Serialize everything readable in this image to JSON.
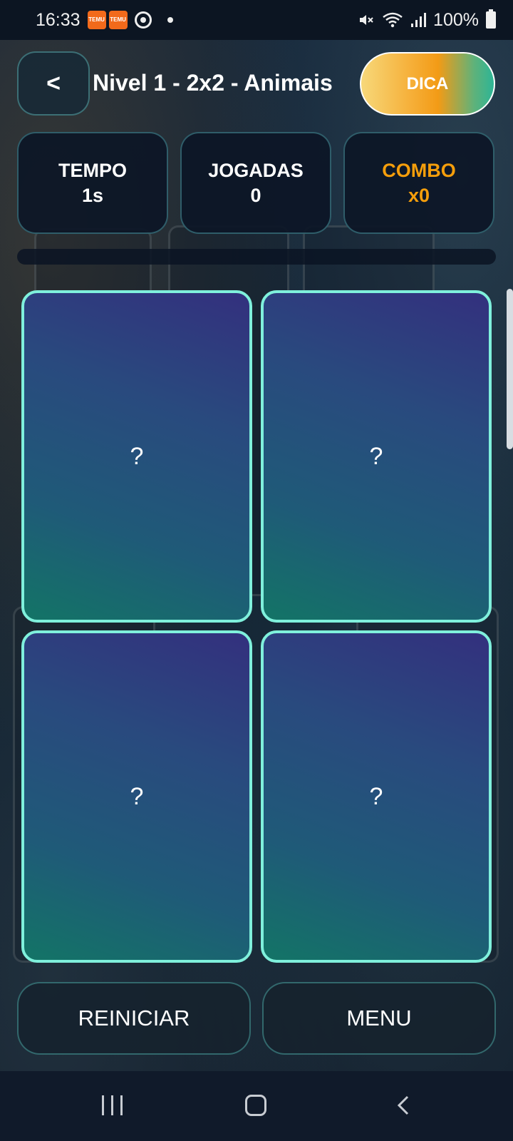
{
  "status_bar": {
    "time": "16:33",
    "notification_icons": [
      "temu-icon",
      "temu-icon",
      "sync-icon",
      "dot-icon"
    ],
    "temu_label": "TEMU",
    "battery": "100%"
  },
  "header": {
    "back_label": "<",
    "title": "Nivel 1 - 2x2 - Animais",
    "hint_label": "DICA"
  },
  "stats": {
    "time_label": "TEMPO",
    "time_value": "1s",
    "moves_label": "JOGADAS",
    "moves_value": "0",
    "combo_label": "COMBO",
    "combo_value": "x0"
  },
  "progress": {
    "fraction": 0
  },
  "cards": [
    {
      "face": "?"
    },
    {
      "face": "?"
    },
    {
      "face": "?"
    },
    {
      "face": "?"
    }
  ],
  "actions": {
    "restart_label": "REINICIAR",
    "menu_label": "MENU"
  },
  "colors": {
    "card_border": "#7ff0dc",
    "combo_accent": "#f59e0b",
    "hint_gradient_start": "#f7d87a",
    "hint_gradient_end": "#2db596"
  }
}
